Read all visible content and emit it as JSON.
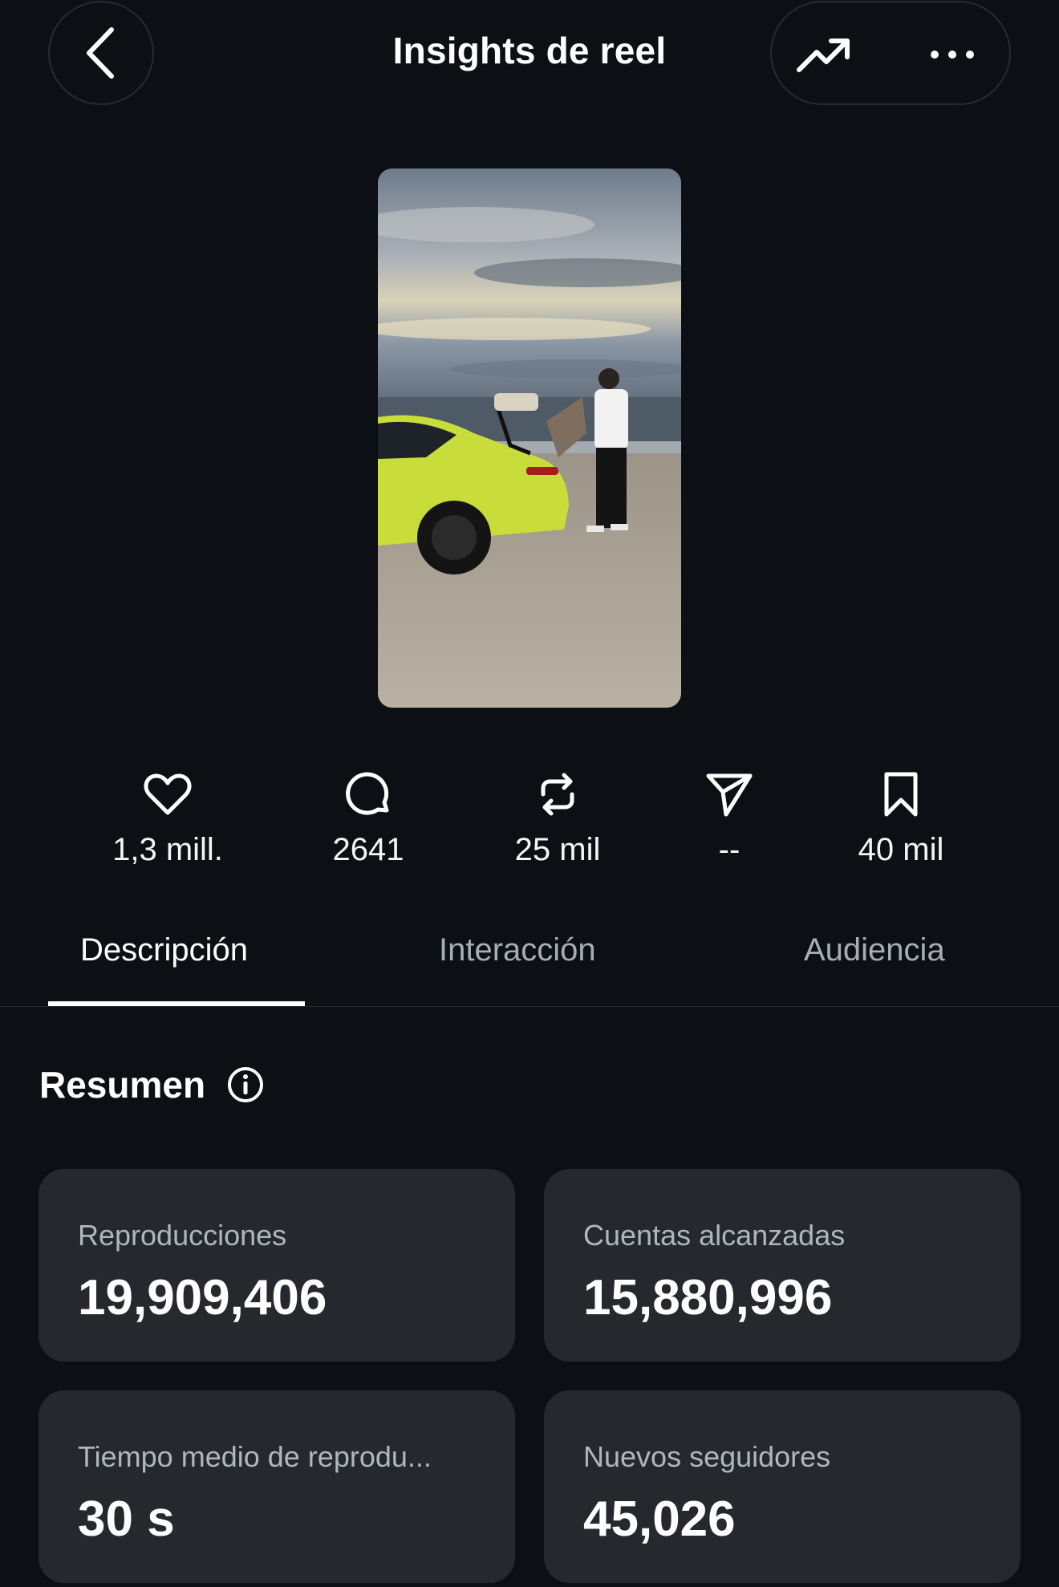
{
  "header": {
    "title": "Insights de reel",
    "back_icon": "chevron-left-icon",
    "trend_icon": "trending-up-icon",
    "more_icon": "more-horizontal-icon"
  },
  "thumbnail": {
    "description_icon": "reel-thumbnail"
  },
  "stats": [
    {
      "icon": "heart-icon",
      "value": "1,3 mill."
    },
    {
      "icon": "comment-icon",
      "value": "2641"
    },
    {
      "icon": "repost-icon",
      "value": "25 mil"
    },
    {
      "icon": "share-icon",
      "value": "--"
    },
    {
      "icon": "bookmark-icon",
      "value": "40 mil"
    }
  ],
  "tabs": [
    {
      "label": "Descripción",
      "active": true
    },
    {
      "label": "Interacción",
      "active": false
    },
    {
      "label": "Audiencia",
      "active": false
    }
  ],
  "summary": {
    "title": "Resumen",
    "cards": [
      {
        "label": "Reproducciones",
        "value": "19,909,406"
      },
      {
        "label": "Cuentas alcanzadas",
        "value": "15,880,996"
      },
      {
        "label": "Tiempo medio de reprodu...",
        "value": "30 s"
      },
      {
        "label": "Nuevos seguidores",
        "value": "45,026"
      }
    ]
  },
  "colors": {
    "background": "#0c1014",
    "card": "#25292e",
    "muted_text": "#a8adb4",
    "car": "#c8dc3a"
  }
}
